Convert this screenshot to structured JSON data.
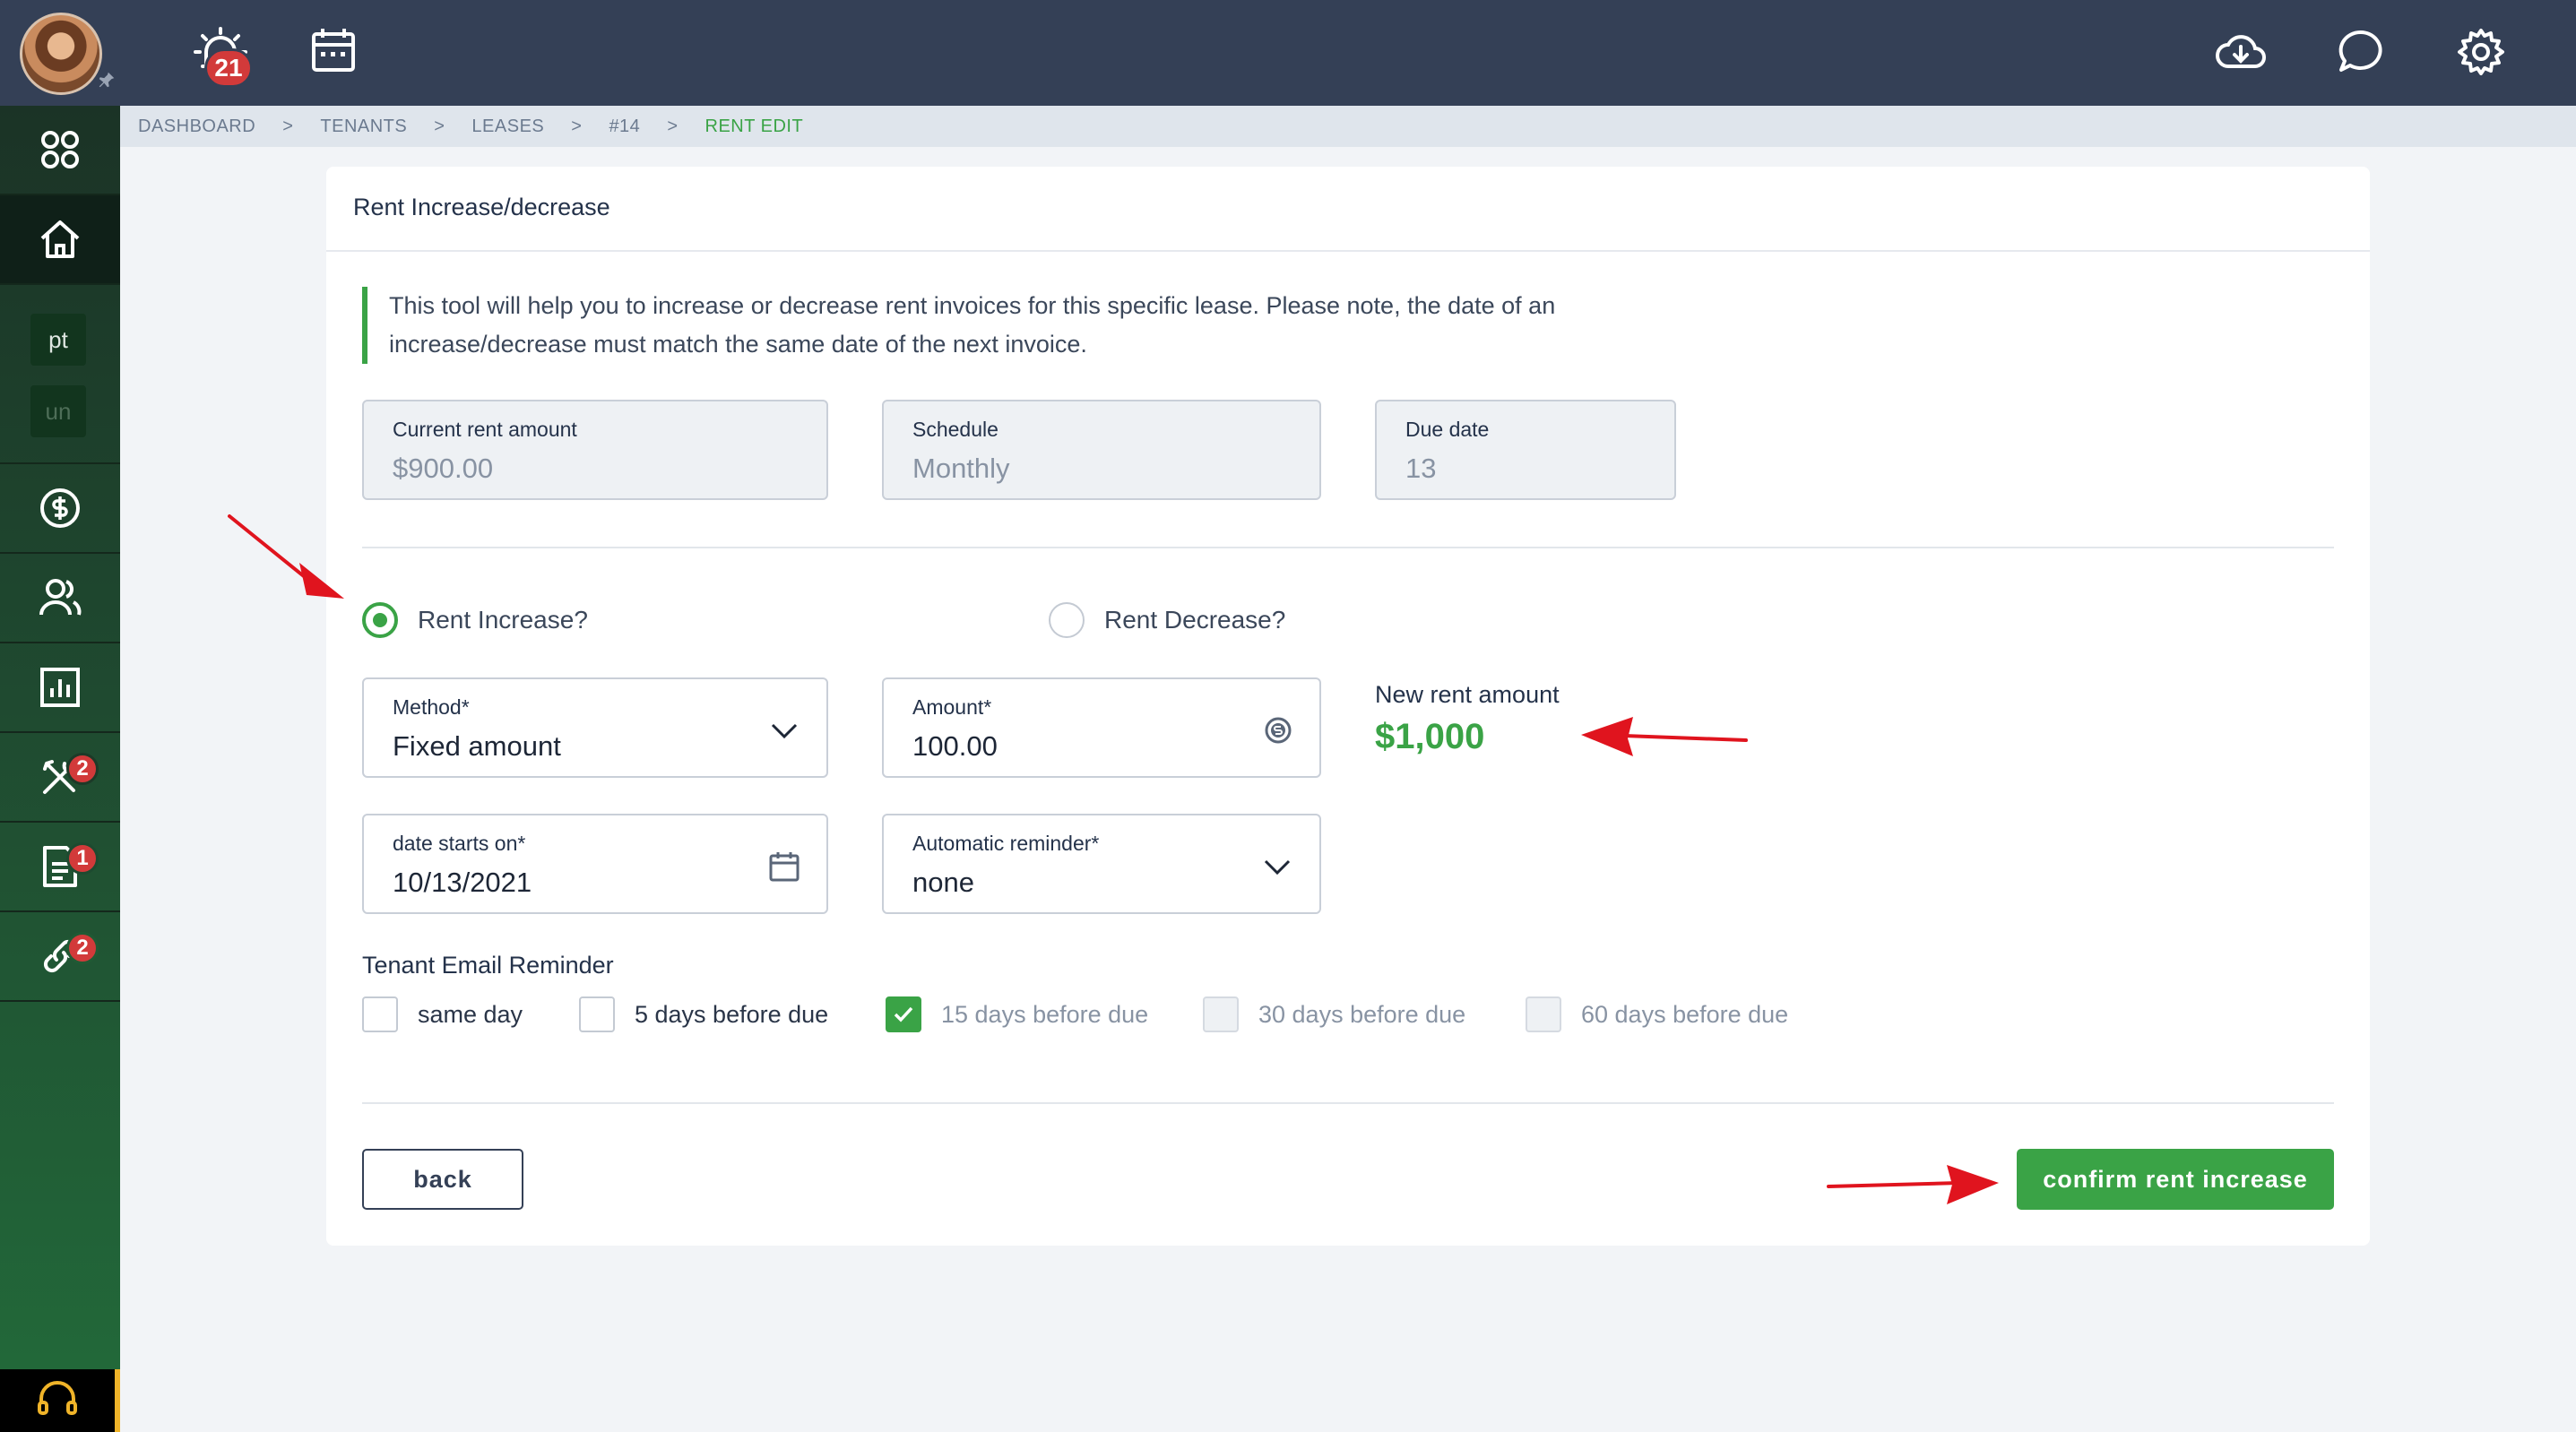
{
  "topbar": {
    "notification_count": "21"
  },
  "sidebar": {
    "chip_1": "pt",
    "chip_2": "un",
    "maintenance_badge": "2",
    "documents_badge": "1",
    "links_badge": "2"
  },
  "breadcrumb": {
    "items": [
      "DASHBOARD",
      "TENANTS",
      "LEASES",
      "#14",
      "RENT EDIT"
    ],
    "separator": ">"
  },
  "card": {
    "title": "Rent Increase/decrease",
    "notice": "This tool will help you to increase or decrease rent invoices for this specific lease. Please note, the date of an increase/decrease must match the same date of the next invoice."
  },
  "summary": {
    "current_rent_label": "Current rent amount",
    "current_rent_value": "$900.00",
    "schedule_label": "Schedule",
    "schedule_value": "Monthly",
    "due_date_label": "Due date",
    "due_date_value": "13"
  },
  "mode": {
    "increase_label": "Rent Increase?",
    "decrease_label": "Rent Decrease?",
    "selected": "increase"
  },
  "form": {
    "method_label": "Method*",
    "method_value": "Fixed amount",
    "amount_label": "Amount*",
    "amount_value": "100.00",
    "date_label": "date starts on*",
    "date_value": "10/13/2021",
    "reminder_label": "Automatic reminder*",
    "reminder_value": "none"
  },
  "new_rent": {
    "label": "New rent amount",
    "value": "$1,000"
  },
  "email_reminder": {
    "title": "Tenant Email Reminder",
    "options": [
      {
        "label": "same day",
        "checked": false,
        "disabled": false
      },
      {
        "label": "5 days before due",
        "checked": false,
        "disabled": false
      },
      {
        "label": "15 days before due",
        "checked": true,
        "disabled": false
      },
      {
        "label": "30 days before due",
        "checked": false,
        "disabled": true
      },
      {
        "label": "60 days before due",
        "checked": false,
        "disabled": true
      }
    ]
  },
  "actions": {
    "back_label": "back",
    "confirm_label": "confirm rent increase"
  },
  "colors": {
    "accent": "#3aa346",
    "topbar": "#344056",
    "annotation_arrow": "#e0141e"
  }
}
